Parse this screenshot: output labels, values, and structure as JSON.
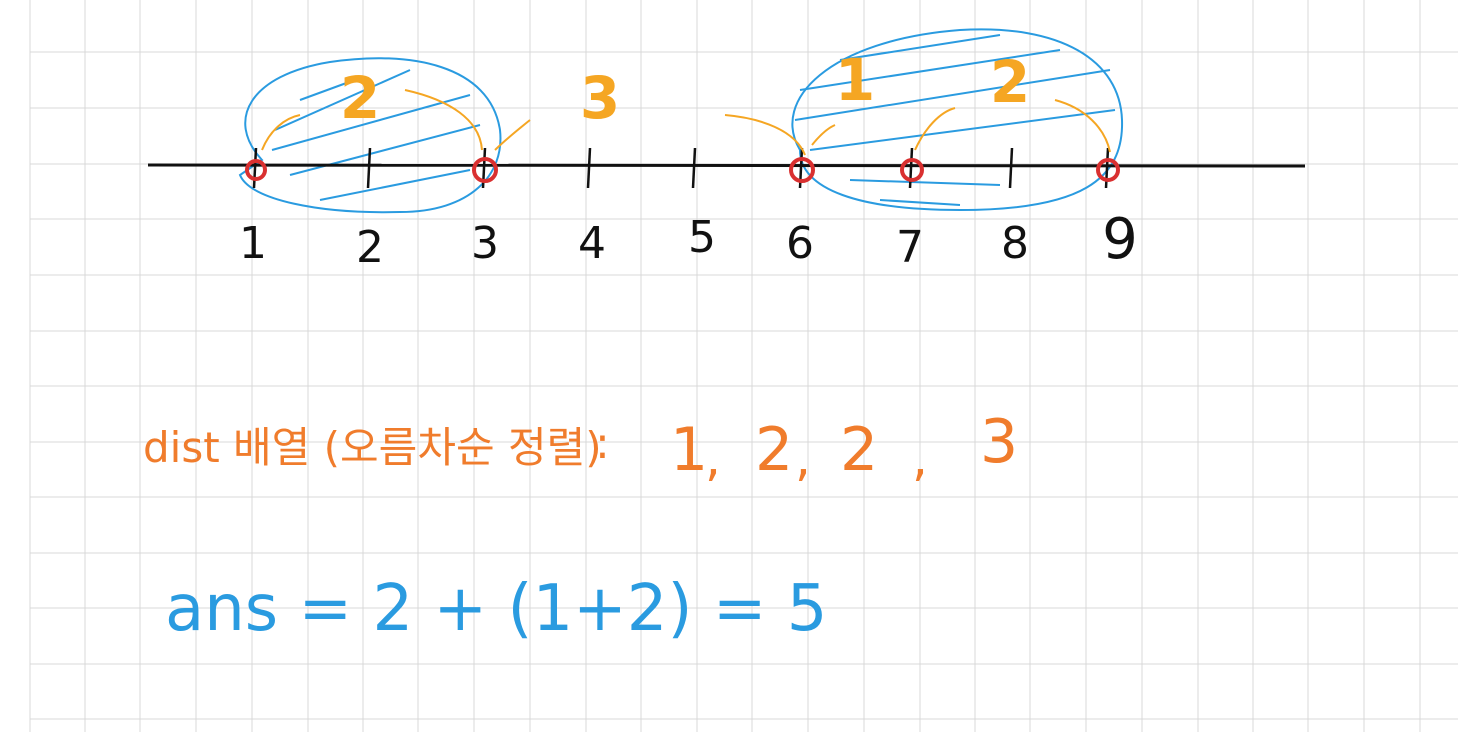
{
  "number_line": {
    "tick_labels": [
      "1",
      "2",
      "3",
      "4",
      "5",
      "6",
      "7",
      "8",
      "9"
    ],
    "marked_points": [
      "1",
      "3",
      "6",
      "7",
      "9"
    ]
  },
  "gap_annotations": [
    {
      "label": "2",
      "color": "#f5a623"
    },
    {
      "label": "3",
      "color": "#f5a623"
    },
    {
      "label": "1",
      "color": "#f5a623"
    },
    {
      "label": "2",
      "color": "#f5a623"
    }
  ],
  "dist_line": {
    "label": "dist 배열 (오름차순 정렬)",
    "colon": ":",
    "values": [
      "1",
      "2",
      "2",
      "3"
    ],
    "color": "#f07c2c"
  },
  "ans_line": {
    "text": "ans = 2 + (1+2) = 5",
    "color": "#2a9be0"
  },
  "colors": {
    "grid": "#d9d9d9",
    "axis": "#111111",
    "group": "#2a9be0",
    "point": "#d93030",
    "gap": "#f5a623"
  }
}
